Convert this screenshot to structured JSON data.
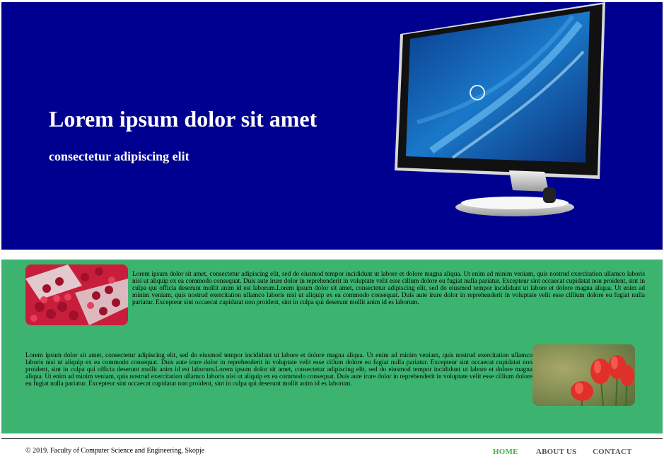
{
  "hero": {
    "title": "Lorem ipsum dolor sit amet",
    "subtitle": "consectetur adipiscing elit",
    "background": "#000090"
  },
  "content": {
    "background": "#3cb470",
    "row1_text": "Lorem ipsum dolor sit amet, consectetur adipiscing elit, sed do eiusmod tempor incididunt ut labore et dolore magna aliqua. Ut enim ad minim veniam, quis nostrud exercitation ullamco laboris nisi ut aliquip ex ea commodo consequat. Duis aute irure dolor in reprehenderit in voluptate velit esse cillum dolore eu fugiat nulla pariatur. Excepteur sint occaecat cupidatat non proident, sint in culpa qui officia deserunt mollit anim id est laborum.Lorem ipsum dolor sit amet, consectetur adipiscing elit, sed do eiusmod tempor incididunt ut labore et dolore magna aliqua. Ut enim ad minim veniam, quis nostrud exercitation ullamco laboris nisi ut aliquip ex ea commodo consequat. Duis aute irure dolor in reprehenderit in voluptate velit esse cillium dolore eu fugiat nulla pariatur. Excepteur sint occaecat cupidatat non proident, sint in culpa qui deserunt mollit anim id es laborum.",
    "row2_text": "Lorem ipsum dolor sit amet, consectetur adipiscing elit, sed do eiusmod tempor incididunt ut labore et dolore magna aliqua. Ut enim ad minim veniam, quis nostrud exercitation ullamco laboris nisi ut aliquip ex ea commodo consequat. Duis aute irure dolor in reprehenderit in voluptate velit esse cillum dolore eu fugiat nulla pariatur. Excepteur sint occaecat cupidatat non proident, sint in culpa qui officia deserunt mollit anim id est laborum.Lorem ipsum dolor sit amet, consectetur adipiscing elit, sed do eiusmod tempor incididunt ut labore et dolore magna aliqua. Ut enim ad minim veniam, quis nostrud exercitation ullamco laboris nisi ut aliquip ex ea commodo consequat. Duis aute irure dolor in reprehenderit in voluptate velit esse cillium dolore eu fugiat nulla pariatur. Excepteur sint occaecat cupidatat non proident, sint in culpa qui deserunt mollit anim id es laborum."
  },
  "footer": {
    "copyright": "© 2019. Faculty of Computer Science and Engineering, Skopje",
    "nav": [
      {
        "label": "HOME",
        "active": true
      },
      {
        "label": "ABOUT US",
        "active": false
      },
      {
        "label": "CONTACT",
        "active": false
      }
    ],
    "active_color": "#3cb44a"
  }
}
